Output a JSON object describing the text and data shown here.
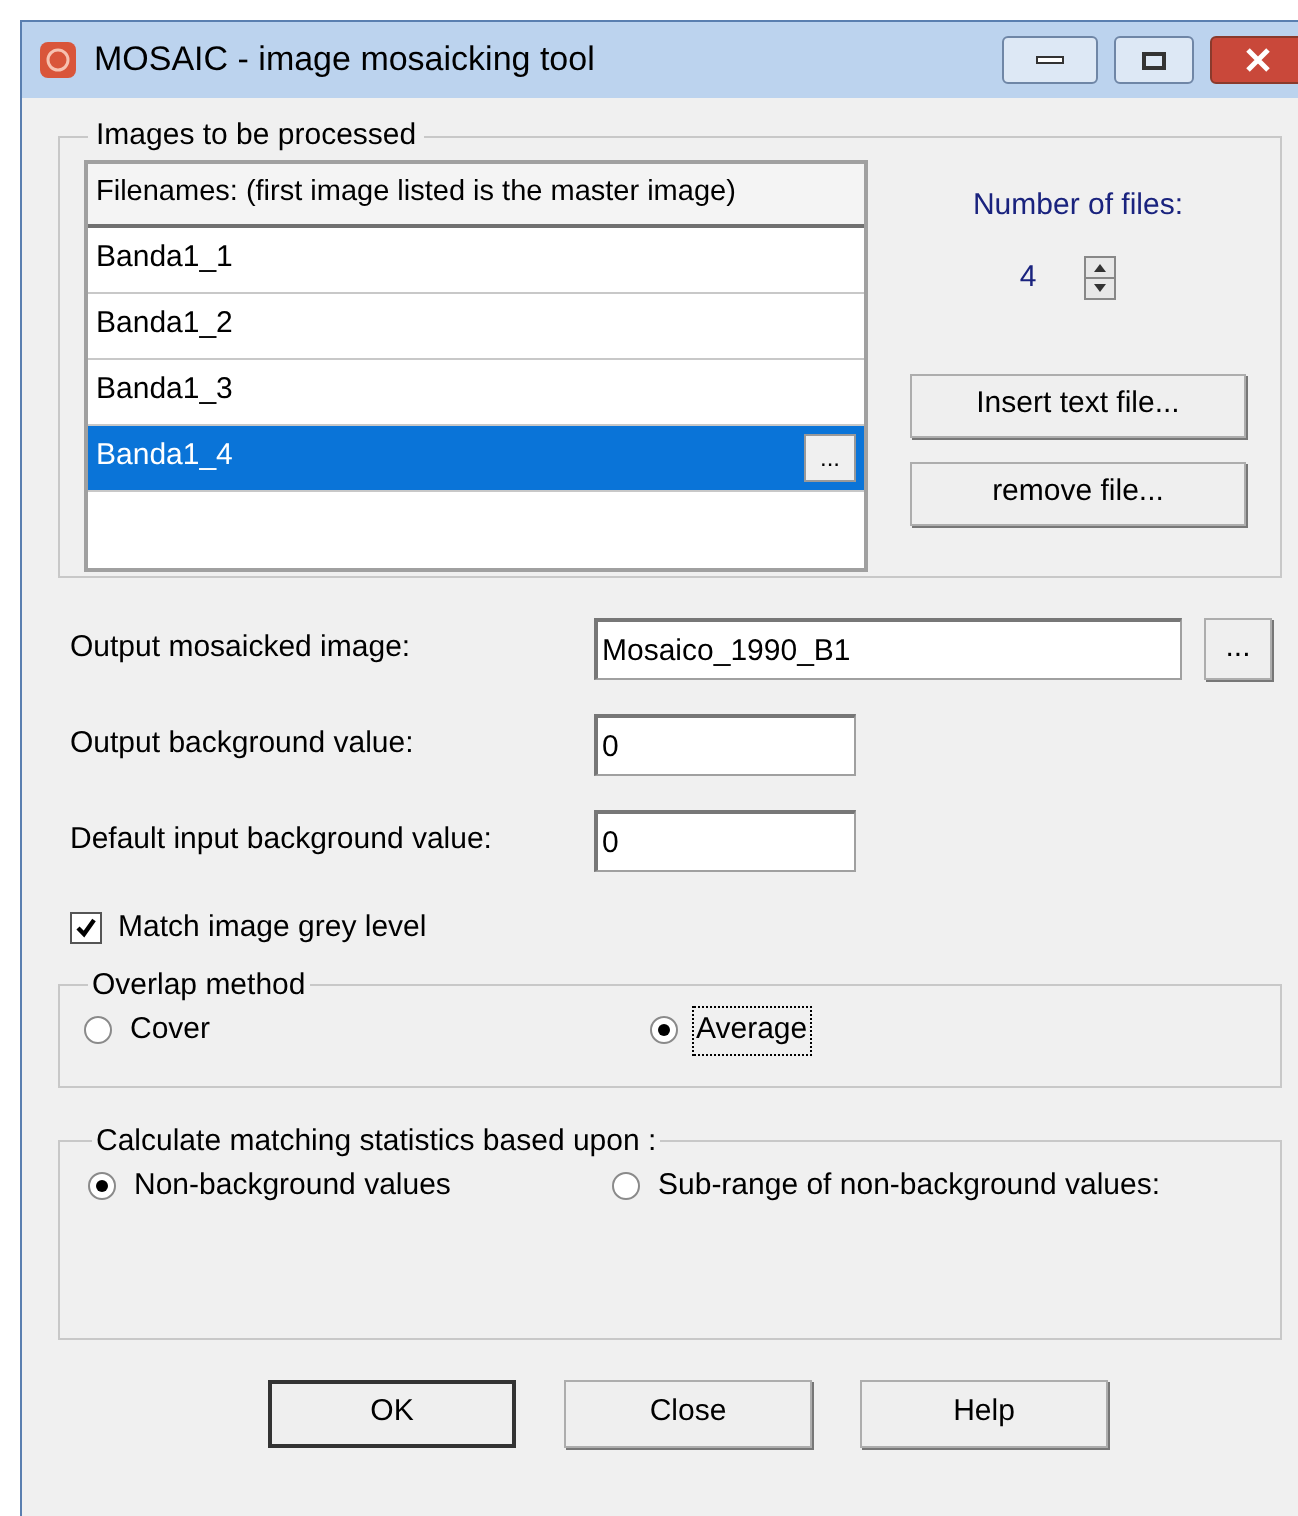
{
  "window": {
    "title": "MOSAIC - image mosaicking tool"
  },
  "images_group": {
    "title": "Images to be processed",
    "list": {
      "header": "Filenames: (first image listed is the master image)",
      "rows": [
        {
          "text": "Banda1_1",
          "selected": false
        },
        {
          "text": "Banda1_2",
          "selected": false
        },
        {
          "text": "Banda1_3",
          "selected": false
        },
        {
          "text": "Banda1_4",
          "selected": true,
          "browse": "..."
        }
      ]
    },
    "number_of_files": {
      "label": "Number of files:",
      "value": "4"
    },
    "buttons": [
      "Insert text file...",
      "remove file..."
    ]
  },
  "fields": [
    {
      "kind": "file",
      "label": "Output mosaicked image:",
      "value": "Mosaico_1990_B1",
      "browse": "..."
    },
    {
      "kind": "number",
      "label": "Output background value:",
      "value": "0"
    },
    {
      "kind": "number",
      "label": "Default input background value:",
      "value": "0"
    }
  ],
  "checkbox": {
    "label": "Match image grey level",
    "checked": true
  },
  "overlap": {
    "title": "Overlap method",
    "options": [
      {
        "label": "Cover",
        "selected": false,
        "focused": false
      },
      {
        "label": "Average",
        "selected": true,
        "focused": true
      }
    ]
  },
  "statistics": {
    "title": "Calculate matching statistics based upon :",
    "options": [
      {
        "label": "Non-background values",
        "selected": true,
        "focused": false
      },
      {
        "label": "Sub-range of non-background values:",
        "selected": false,
        "focused": false
      }
    ]
  },
  "buttons": [
    {
      "label": "OK",
      "default": true
    },
    {
      "label": "Close",
      "default": false
    },
    {
      "label": "Help",
      "default": false
    }
  ]
}
